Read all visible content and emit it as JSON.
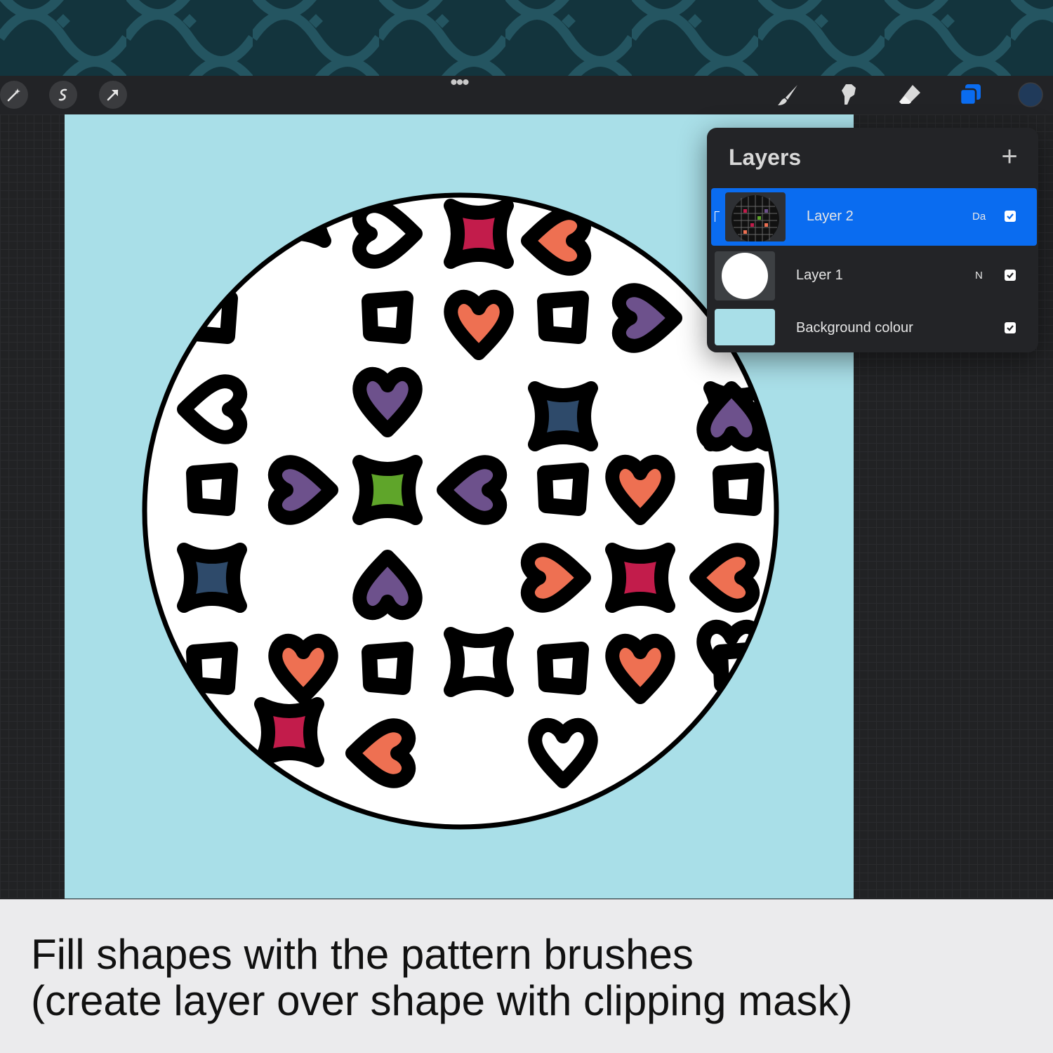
{
  "toolbar": {
    "left_tools": [
      "adjustments-icon",
      "selection-icon",
      "transform-icon"
    ],
    "menu_dots": "•••",
    "right_tools": [
      "brush-icon",
      "smudge-icon",
      "eraser-icon",
      "layers-icon",
      "colour-picker"
    ],
    "active_tool": "layers-icon",
    "current_colour": "#203a5a"
  },
  "layers_panel": {
    "title": "Layers",
    "add_symbol": "+",
    "layers": [
      {
        "name": "Layer 2",
        "blend_mode": "Da",
        "visible": true,
        "selected": true,
        "clipping_mask": true
      },
      {
        "name": "Layer 1",
        "blend_mode": "N",
        "visible": true,
        "selected": false
      },
      {
        "name": "Background colour",
        "visible": true,
        "selected": false
      }
    ]
  },
  "canvas": {
    "background_colour": "#a9dfe8",
    "palette": {
      "red": "#c21c4b",
      "coral": "#ee7052",
      "purple": "#6d518c",
      "green": "#5fa52a",
      "navy": "#2e4a6a"
    }
  },
  "caption": {
    "line1": "Fill shapes with the pattern brushes",
    "line2": "(create layer over shape with clipping mask)"
  },
  "colors": {
    "accent": "#0a6cf0",
    "banner": "#13343d"
  }
}
